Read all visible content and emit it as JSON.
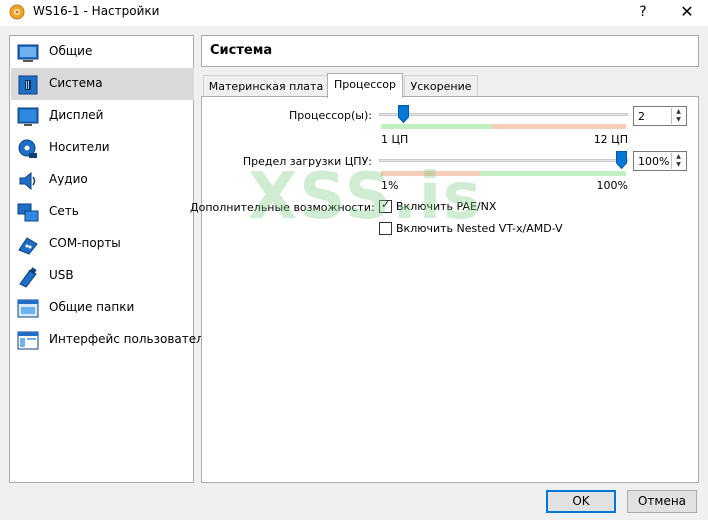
{
  "window": {
    "title": "WS16-1 - Настройки",
    "help_label": "?",
    "close_label": "✕"
  },
  "sidebar": {
    "items": [
      {
        "label": "Общие",
        "icon": "general-icon"
      },
      {
        "label": "Система",
        "icon": "system-icon",
        "selected": true
      },
      {
        "label": "Дисплей",
        "icon": "display-icon"
      },
      {
        "label": "Носители",
        "icon": "storage-icon"
      },
      {
        "label": "Аудио",
        "icon": "audio-icon"
      },
      {
        "label": "Сеть",
        "icon": "network-icon"
      },
      {
        "label": "COM-порты",
        "icon": "serial-ports-icon"
      },
      {
        "label": "USB",
        "icon": "usb-icon"
      },
      {
        "label": "Общие папки",
        "icon": "shared-folders-icon"
      },
      {
        "label": "Интерфейс пользователя",
        "icon": "user-interface-icon"
      }
    ]
  },
  "section": {
    "title": "Система"
  },
  "tabs": [
    {
      "label": "Материнская плата",
      "active": false
    },
    {
      "label": "Процессор",
      "active": true
    },
    {
      "label": "Ускорение",
      "active": false
    }
  ],
  "processor": {
    "cpu_label": "Процессор(ы):",
    "cpu_value": "2",
    "cpu_min_label": "1 ЦП",
    "cpu_max_label": "12 ЦП",
    "cpu_count": 2,
    "cpu_min": 1,
    "cpu_max": 12,
    "cap_label": "Предел загрузки ЦПУ:",
    "cap_value": "100%",
    "cap_min_label": "1%",
    "cap_max_label": "100%",
    "cap_percent": 100,
    "extended_label": "Дополнительные возможности:",
    "pae_label": "Включить PAE/NX",
    "pae_checked": true,
    "nested_label": "Включить Nested VT-x/AMD-V",
    "nested_checked": false
  },
  "watermark": "XSS.is",
  "buttons": {
    "ok": "OK",
    "cancel": "Отмена"
  },
  "colors": {
    "accent": "#0078d7",
    "slider_green": "#c3f0c3",
    "slider_red": "#f6cdb9",
    "selected_item": "#d9d9d9"
  }
}
